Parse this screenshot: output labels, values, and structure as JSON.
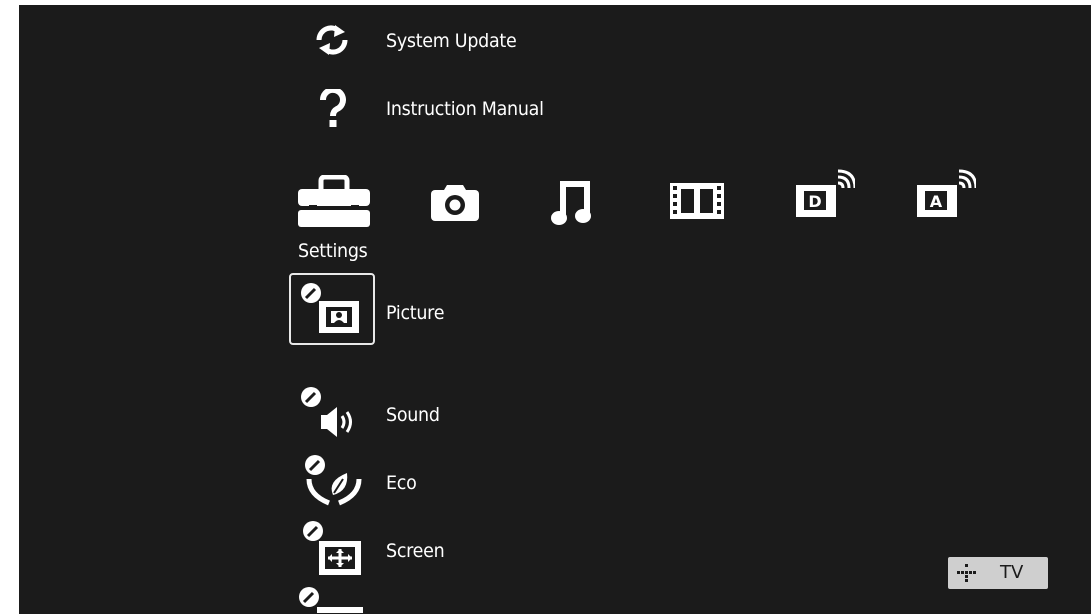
{
  "menu": {
    "top_items": [
      {
        "label": "System Update",
        "icon": "refresh-arrows-icon"
      },
      {
        "label": "Instruction Manual",
        "icon": "question-mark-icon"
      }
    ],
    "categories": [
      {
        "label": "Settings",
        "icon": "toolbox-icon",
        "selected": true
      },
      {
        "icon": "camera-icon"
      },
      {
        "icon": "music-note-icon"
      },
      {
        "icon": "film-strip-icon"
      },
      {
        "icon": "digital-broadcast-icon",
        "badge": "D"
      },
      {
        "icon": "analog-broadcast-icon",
        "badge": "A"
      }
    ],
    "settings_items": [
      {
        "label": "Picture",
        "icon": "picture-settings-icon",
        "focused": true
      },
      {
        "label": "Sound",
        "icon": "sound-settings-icon"
      },
      {
        "label": "Eco",
        "icon": "eco-settings-icon"
      },
      {
        "label": "Screen",
        "icon": "screen-settings-icon"
      },
      {
        "label": "",
        "icon": "more-settings-icon"
      }
    ]
  },
  "input_badge": {
    "label": "TV",
    "icon": "tv-input-dots-icon"
  },
  "colors": {
    "background": "#1b1b1b",
    "text": "#ffffff",
    "badge_bg": "#cfcfcf"
  }
}
